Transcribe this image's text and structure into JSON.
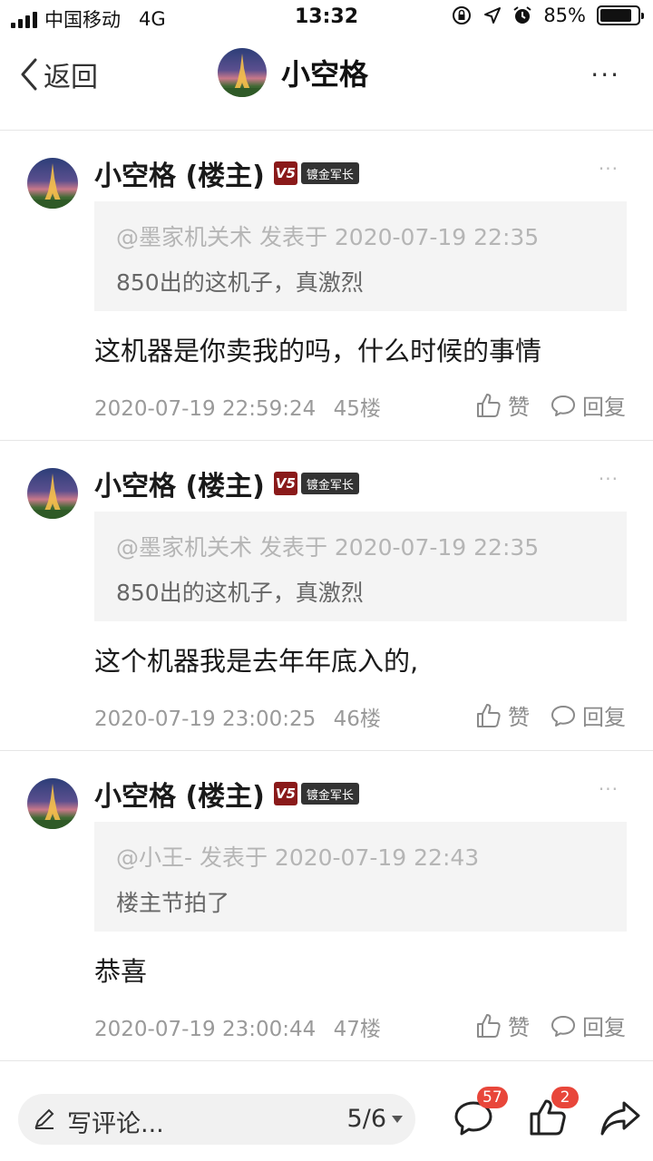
{
  "status_bar": {
    "carrier": "中国移动",
    "network": "4G",
    "time": "13:32",
    "battery_text": "85%",
    "battery_level": 0.85
  },
  "nav": {
    "back_label": "返回",
    "title": "小空格",
    "more": "···"
  },
  "posts": [
    {
      "author": "小空格 (楼主)",
      "level": "V5",
      "badge": "镀金军长",
      "more": "···",
      "quote_meta": "@墨家机关术 发表于 2020-07-19 22:35",
      "quote_text": "850出的这机子，真激烈",
      "body": "这机器是你卖我的吗，什么时候的事情",
      "time": "2020-07-19 22:59:24",
      "floor": "45楼",
      "like_label": "赞",
      "reply_label": "回复"
    },
    {
      "author": "小空格 (楼主)",
      "level": "V5",
      "badge": "镀金军长",
      "more": "···",
      "quote_meta": "@墨家机关术 发表于 2020-07-19 22:35",
      "quote_text": "850出的这机子，真激烈",
      "body": "这个机器我是去年年底入的,",
      "time": "2020-07-19 23:00:25",
      "floor": "46楼",
      "like_label": "赞",
      "reply_label": "回复"
    },
    {
      "author": "小空格 (楼主)",
      "level": "V5",
      "badge": "镀金军长",
      "more": "···",
      "quote_meta": "@小王- 发表于 2020-07-19 22:43",
      "quote_text": "楼主节拍了",
      "body": "恭喜",
      "time": "2020-07-19 23:00:44",
      "floor": "47楼",
      "like_label": "赞",
      "reply_label": "回复"
    }
  ],
  "bottom_bar": {
    "comment_placeholder": "写评论...",
    "page_indicator": "5/6",
    "comment_count": "57",
    "like_count": "2"
  },
  "colors": {
    "level_badge": "#8a1a1a",
    "rank_badge": "#333333",
    "count_badge": "#e8463a",
    "quote_bg": "#f4f4f4"
  },
  "icons": [
    "signal-icon",
    "lock-rotation-icon",
    "location-icon",
    "alarm-icon",
    "battery-icon",
    "back-chevron-icon",
    "more-icon",
    "thumbs-up-icon",
    "reply-bubble-icon",
    "pen-icon",
    "comment-icon",
    "like-icon",
    "share-icon"
  ]
}
